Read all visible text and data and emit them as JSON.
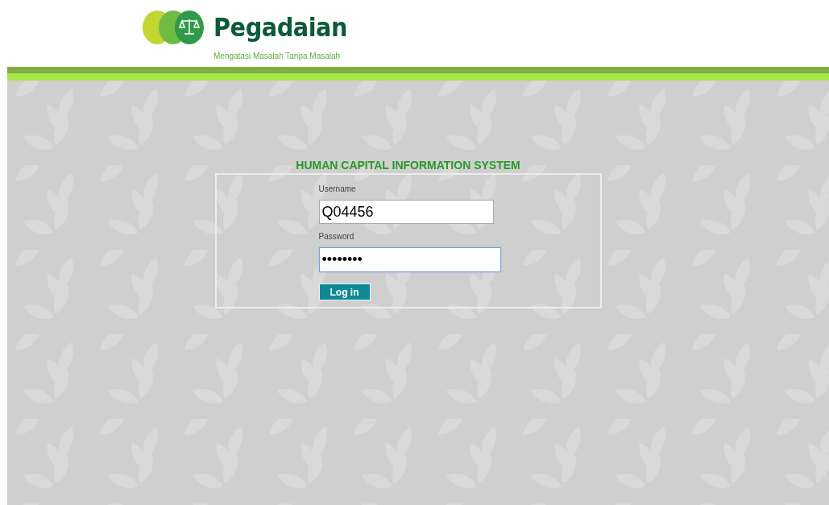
{
  "header": {
    "brand": "Pegadaian",
    "tagline": "Mengatasi Masalah Tanpa Masalah"
  },
  "login": {
    "title": "HUMAN CAPITAL INFORMATION SYSTEM",
    "fields": [
      {
        "label": "Username",
        "value": "Q04456",
        "focused": false,
        "wide": false
      },
      {
        "label": "Password",
        "value": "••••••••",
        "focused": true,
        "wide": true
      }
    ],
    "button": "Log in"
  }
}
